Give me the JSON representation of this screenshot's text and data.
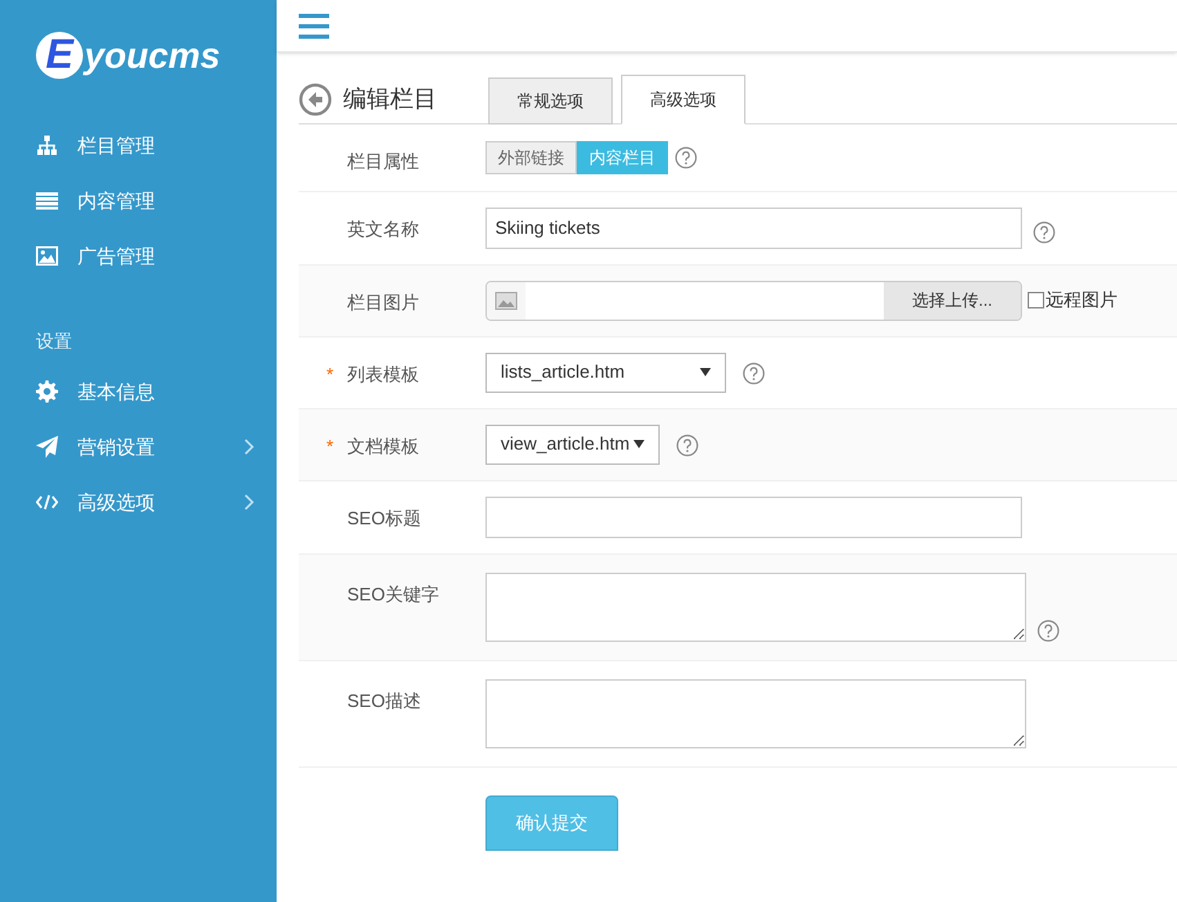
{
  "logo": {
    "mark": "E",
    "text": "youcms"
  },
  "sidebar": {
    "items": [
      {
        "label": "栏目管理",
        "has_submenu": false
      },
      {
        "label": "内容管理",
        "has_submenu": false
      },
      {
        "label": "广告管理",
        "has_submenu": false
      }
    ],
    "section": {
      "title": "设置",
      "items": [
        {
          "label": "基本信息",
          "has_submenu": false
        },
        {
          "label": "营销设置",
          "has_submenu": true
        },
        {
          "label": "高级选项",
          "has_submenu": true
        }
      ]
    }
  },
  "page": {
    "title": "编辑栏目",
    "tabs": [
      {
        "label": "常规选项",
        "selected": false
      },
      {
        "label": "高级选项",
        "selected": true
      }
    ]
  },
  "form": {
    "required_mark": "*",
    "rows": [
      {
        "kind": "toggle",
        "label": "栏目属性",
        "required": false,
        "help": true,
        "options": [
          {
            "label": "外部链接",
            "selected": false
          },
          {
            "label": "内容栏目",
            "selected": true
          }
        ]
      },
      {
        "kind": "text",
        "label": "英文名称",
        "required": false,
        "help": true,
        "value": "Skiing tickets"
      },
      {
        "kind": "upload",
        "label": "栏目图片",
        "required": false,
        "help": false,
        "button": "选择上传...",
        "checkbox": {
          "label": "远程图片",
          "checked": false
        }
      },
      {
        "kind": "select",
        "label": "列表模板",
        "required": true,
        "help": true,
        "value": "lists_article.htm"
      },
      {
        "kind": "select",
        "label": "文档模板",
        "required": true,
        "help": true,
        "value": "view_article.htm"
      },
      {
        "kind": "text",
        "label": "SEO标题",
        "required": false,
        "help": false,
        "value": ""
      },
      {
        "kind": "textarea",
        "label": "SEO关键字",
        "required": false,
        "help": true
      },
      {
        "kind": "textarea",
        "label": "SEO描述",
        "required": false,
        "help": false
      }
    ],
    "submit": "确认提交"
  }
}
